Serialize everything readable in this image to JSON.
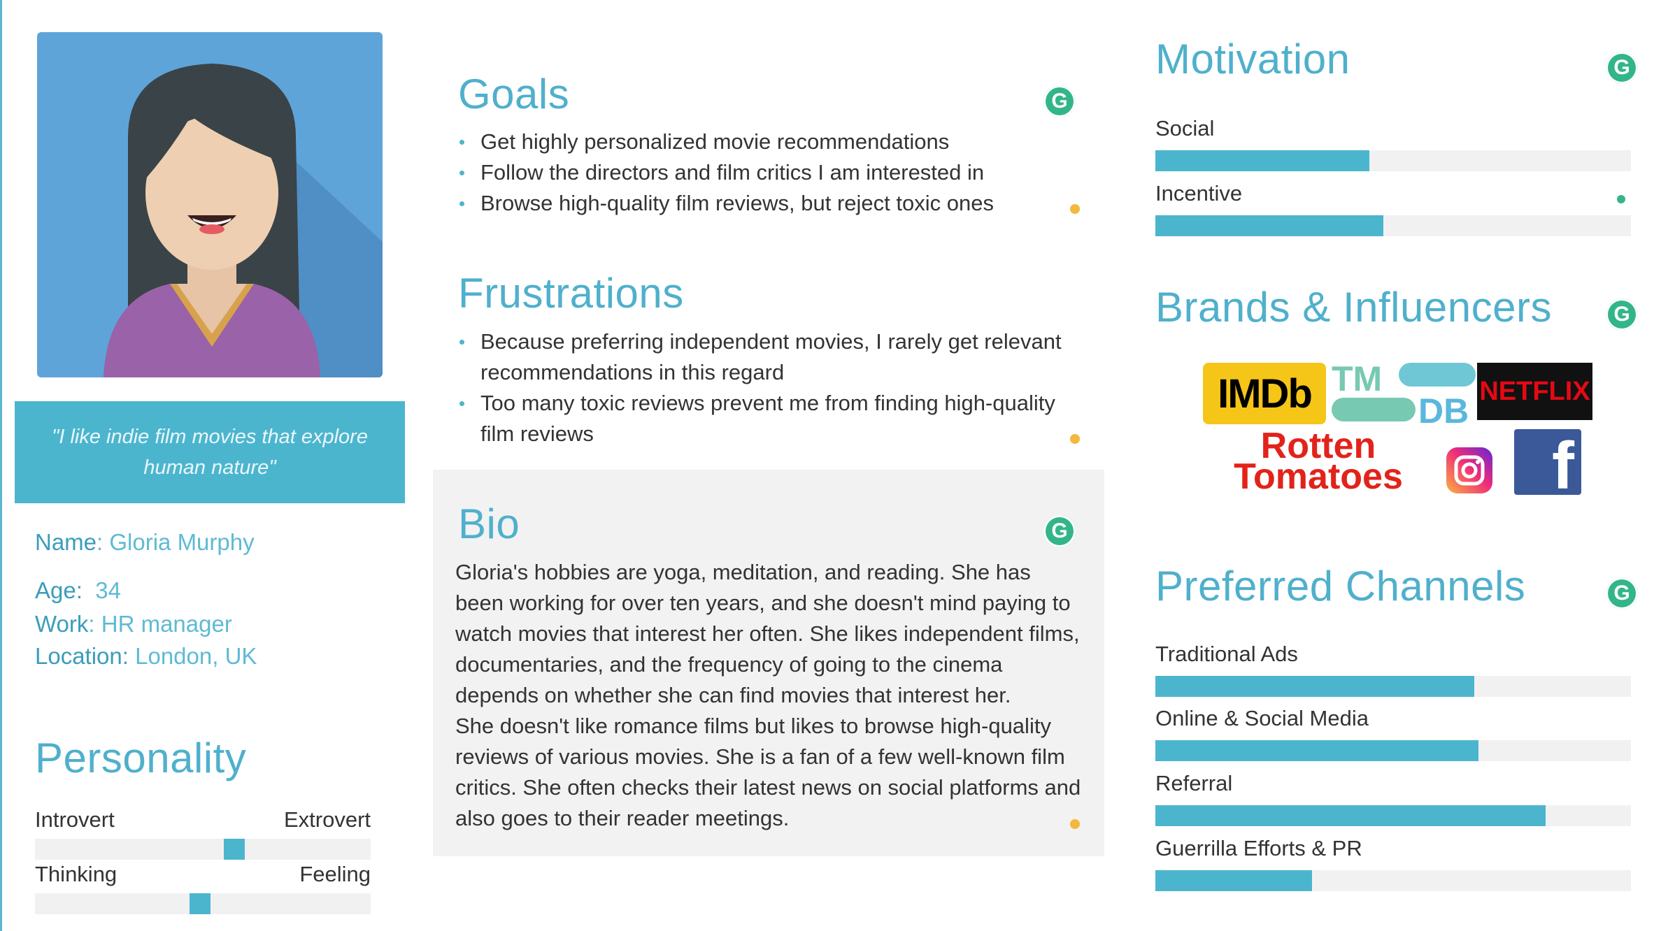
{
  "persona": {
    "quote": "\"I like indie film movies that explore human nature\"",
    "name_label": "Name",
    "name_value": "Gloria Murphy",
    "age_label": "Age:",
    "age_value": "34",
    "work_label": "Work",
    "work_value": "HR manager",
    "location_label": "Location:",
    "location_value": "London, UK"
  },
  "personality": {
    "title": "Personality",
    "scales": [
      {
        "left": "Introvert",
        "right": "Extrovert",
        "value": 0.6
      },
      {
        "left": "Thinking",
        "right": "Feeling",
        "value": 0.49
      }
    ]
  },
  "goals": {
    "title": "Goals",
    "items": [
      "Get highly personalized movie recommendations",
      "Follow the directors and film critics I am interested in",
      "Browse high-quality film reviews, but reject toxic ones"
    ]
  },
  "frustrations": {
    "title": "Frustrations",
    "items": [
      "Because preferring independent movies, I rarely get relevant recommendations in this regard",
      "Too many toxic reviews prevent me from finding high-quality film reviews"
    ]
  },
  "bio": {
    "title": "Bio",
    "lines": [
      "Gloria's hobbies are yoga, meditation, and reading. She has",
      "been working for over ten years, and she doesn't mind paying to",
      "watch movies that interest her often. She likes independent films,",
      "documentaries, and the frequency of going to the cinema",
      "depends on whether she can find movies that interest her.",
      "She doesn't like romance films but likes to browse high-quality",
      "reviews of various movies. She is a fan of a few well-known film",
      "critics. She often checks their latest news on social platforms and",
      "also goes to their reader meetings."
    ]
  },
  "motivation": {
    "title": "Motivation",
    "bars": [
      {
        "label": "Social",
        "value": 0.45
      },
      {
        "label": "Incentive",
        "value": 0.48
      }
    ]
  },
  "brands": {
    "title": "Brands & Influencers",
    "logos": {
      "imdb": "IMDb",
      "tmdb_top": "TM",
      "tmdb_bottom": "DB",
      "netflix": "NETFLIX",
      "rotten_top": "Rotten",
      "rotten_bottom": "Tomatoes",
      "facebook": "f"
    }
  },
  "channels": {
    "title": "Preferred Channels",
    "bars": [
      {
        "label": "Traditional Ads",
        "value": 0.67
      },
      {
        "label": "Online & Social Media",
        "value": 0.68
      },
      {
        "label": "Referral",
        "value": 0.82
      },
      {
        "label": "Guerrilla Efforts & PR",
        "value": 0.33
      }
    ]
  },
  "badges": {
    "grammarly_letter": "G"
  },
  "colors": {
    "accent": "#4cb5ce",
    "badge": "#33b58a",
    "dot": "#f4b83e"
  }
}
